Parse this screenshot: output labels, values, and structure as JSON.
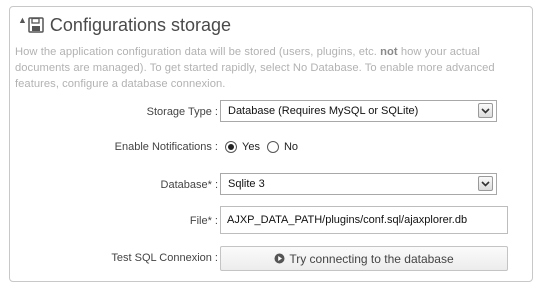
{
  "panel": {
    "title": "Configurations storage",
    "description_part1": "How the application configuration data will be stored (users, plugins, etc. ",
    "description_bold": "not",
    "description_part2": " how your actual documents are managed). To get started rapidly, select No Database. To enable more advanced features, configure a database connexion."
  },
  "storage_type": {
    "label": "Storage Type :",
    "value": "Database (Requires MySQL or SQLite)"
  },
  "notifications": {
    "label": "Enable Notifications :",
    "options": [
      "Yes",
      "No"
    ],
    "selected": "Yes"
  },
  "database": {
    "label": "Database* :",
    "value": "Sqlite 3"
  },
  "file": {
    "label": "File* :",
    "value": "AJXP_DATA_PATH/plugins/conf.sql/ajaxplorer.db"
  },
  "test_sql": {
    "label": "Test SQL Connexion :",
    "button_label": "Try connecting to the database"
  },
  "icons": {
    "collapse": "collapse-arrow-icon",
    "title": "floppy-disk-icon",
    "select": "chevron-down-icon",
    "button": "play-circle-icon"
  }
}
